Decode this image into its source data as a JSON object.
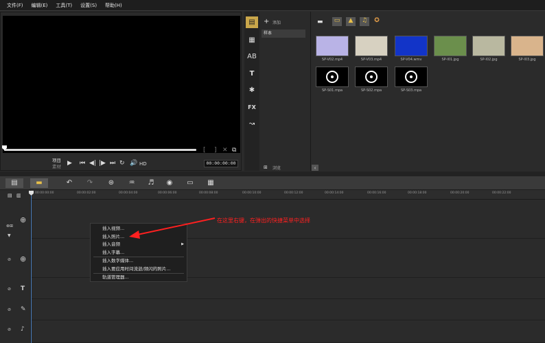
{
  "menu": [
    "文件(F)",
    "编辑(E)",
    "工具(T)",
    "设置(S)",
    "帮助(H)"
  ],
  "player": {
    "mode_project": "项目",
    "mode_clip": "素材",
    "hd_label": "HD",
    "timecode": "00:00:00:00"
  },
  "library": {
    "add_label": "添加",
    "folder_item": "样本",
    "browse_label": "浏览",
    "thumbnails": [
      {
        "caption": "SP-V02.mp4",
        "kind": "video",
        "color": "#b9b3e6"
      },
      {
        "caption": "SP-V03.mp4",
        "kind": "video",
        "color": "#d7d1c1"
      },
      {
        "caption": "SP-V04.wmv",
        "kind": "video",
        "color": "#1234c8"
      },
      {
        "caption": "SP-I01.jpg",
        "kind": "image",
        "color": "#6b8f4c"
      },
      {
        "caption": "SP-I02.jpg",
        "kind": "image",
        "color": "#b9b8a0"
      },
      {
        "caption": "SP-I03.jpg",
        "kind": "image",
        "color": "#d9b48c"
      },
      {
        "caption": "SP-S01.mpa",
        "kind": "audio",
        "color": "#000000"
      },
      {
        "caption": "SP-S02.mpa",
        "kind": "audio",
        "color": "#000000"
      },
      {
        "caption": "SP-S03.mpa",
        "kind": "audio",
        "color": "#000000"
      }
    ]
  },
  "ruler": [
    "00:00:00:00",
    "00:00:02:00",
    "00:00:04:00",
    "00:00:06:00",
    "00:00:08:00",
    "00:00:10:00",
    "00:00:12:00",
    "00:00:14:00",
    "00:00:16:00",
    "00:00:18:00",
    "00:00:20:00",
    "00:00:22:00"
  ],
  "context_menu": {
    "items": [
      "插入视频...",
      "插入照片...",
      "插入音频",
      "插入字幕...",
      "插入数字媒体...",
      "插入要应用时间流逝/频闪的照片...",
      "轨道管理器..."
    ]
  },
  "annotation": "在这里右键，在弹出的快捷菜单中选择",
  "colors": {
    "annotation": "#ff2020",
    "playhead": "#4a7fc0"
  }
}
